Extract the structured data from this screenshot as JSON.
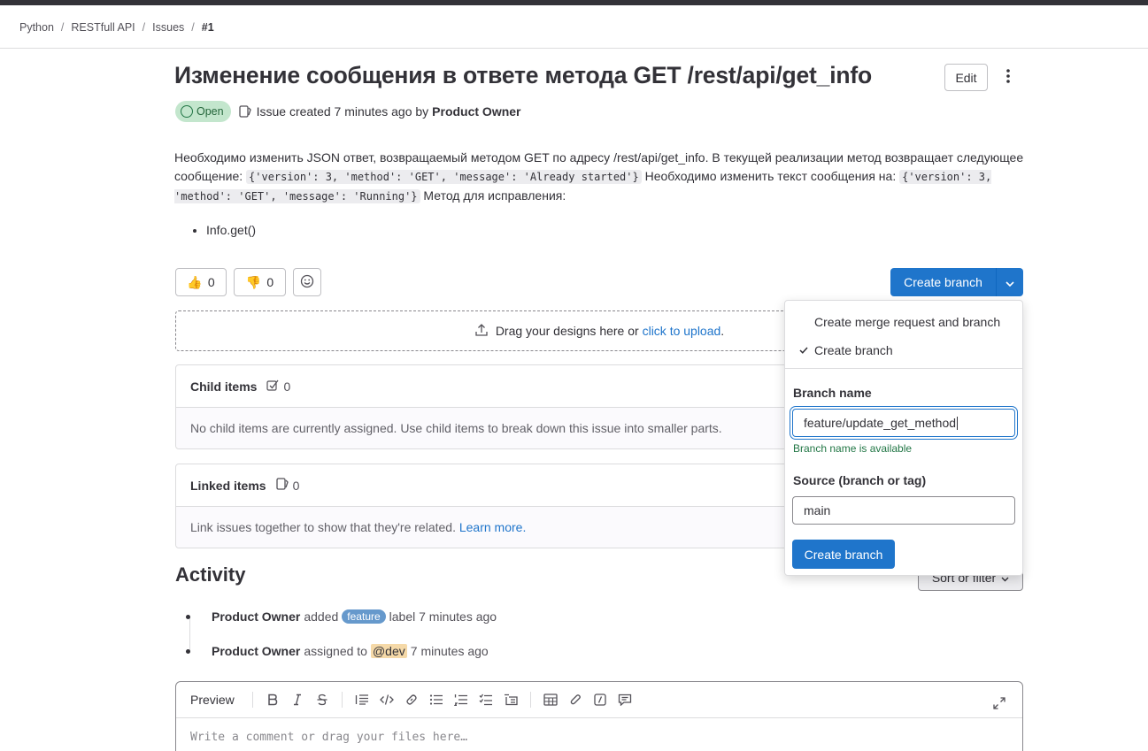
{
  "breadcrumb": {
    "items": [
      "Python",
      "RESTfull API",
      "Issues"
    ],
    "current": "#1"
  },
  "issue": {
    "title": "Изменение сообщения в ответе метода GET /rest/api/get_info",
    "edit_label": "Edit",
    "status": "Open",
    "created_text": "Issue created 7 minutes ago by",
    "author": "Product Owner"
  },
  "description": {
    "text1": "Необходимо изменить JSON ответ, возвращаемый методом GET по адресу /rest/api/get_info. В текущей реализации метод возвращает следующее сообщение: ",
    "code1": "{'version': 3, 'method': 'GET', 'message': 'Already started'}",
    "text2": " Необходимо изменить текст сообщения на: ",
    "code2": "{'version': 3, 'method': 'GET', 'message': 'Running'}",
    "text3": " Метод для исправления:",
    "list": [
      "Info.get()"
    ]
  },
  "reactions": {
    "thumbs_up": {
      "emoji": "👍",
      "count": "0"
    },
    "thumbs_down": {
      "emoji": "👎",
      "count": "0"
    }
  },
  "create_branch_button": "Create branch",
  "dropzone": {
    "text": "Drag your designs here or",
    "link": "click to upload",
    "suffix": "."
  },
  "child_items": {
    "title": "Child items",
    "count": "0",
    "empty_text": "No child items are currently assigned. Use child items to break down this issue into smaller parts."
  },
  "linked_items": {
    "title": "Linked items",
    "count": "0",
    "empty_text": "Link issues together to show that they're related.",
    "link": "Learn more."
  },
  "activity": {
    "title": "Activity",
    "sort_label": "Sort or filter",
    "items": [
      {
        "actor": "Product Owner",
        "action": "added",
        "label": "feature",
        "suffix": "label 7 minutes ago"
      },
      {
        "actor": "Product Owner",
        "action": "assigned to",
        "mention": "@dev",
        "suffix": "7 minutes ago"
      }
    ]
  },
  "editor": {
    "preview_label": "Preview",
    "placeholder": "Write a comment or drag your files here…"
  },
  "dropdown": {
    "options": [
      {
        "label": "Create merge request and branch",
        "checked": false
      },
      {
        "label": "Create branch",
        "checked": true
      }
    ],
    "branch_name_label": "Branch name",
    "branch_name_value": "feature/update_get_method",
    "branch_hint": "Branch name is available",
    "source_label": "Source (branch or tag)",
    "source_value": "main",
    "submit_label": "Create branch"
  },
  "colors": {
    "primary": "#1f75cb",
    "open_badge_bg": "#c3e6cd",
    "open_badge_text": "#24663b",
    "label_feature": "#6699cc",
    "success_text": "#217645"
  }
}
